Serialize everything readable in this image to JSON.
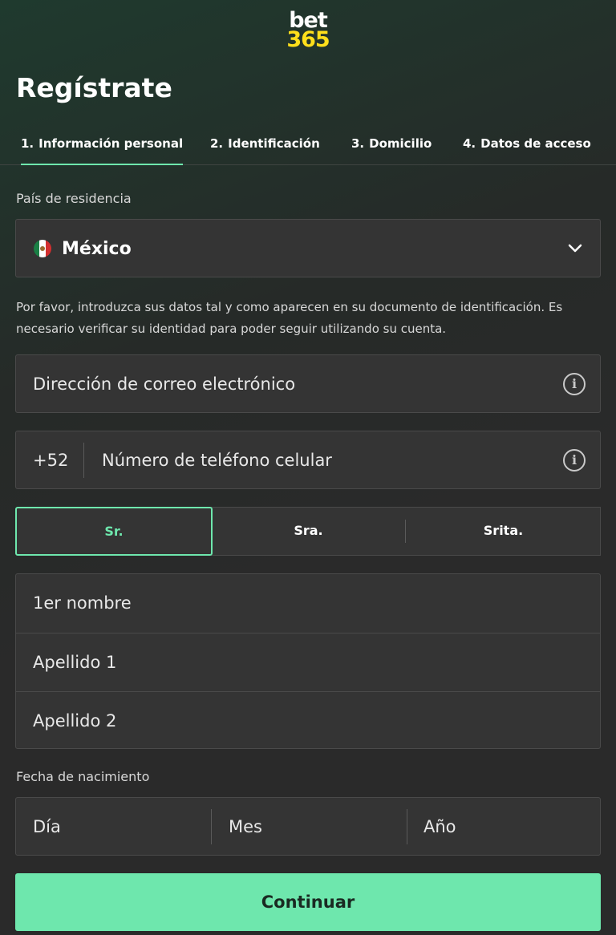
{
  "logo": {
    "line1": "bet",
    "line2": "365"
  },
  "page_title": "Regístrate",
  "tabs": [
    {
      "num": "1.",
      "label": "Información personal"
    },
    {
      "num": "2.",
      "label": "Identificación"
    },
    {
      "num": "3.",
      "label": "Domicilio"
    },
    {
      "num": "4.",
      "label": "Datos de acceso"
    }
  ],
  "country": {
    "label": "País de residencia",
    "value": "México"
  },
  "notice": "Por favor, introduzca sus datos tal y como aparecen en su documento de identificación. Es necesario verificar su identidad para poder seguir utilizando su cuenta.",
  "email": {
    "placeholder": "Dirección de correo electrónico"
  },
  "phone": {
    "prefix": "+52",
    "placeholder": "Número de teléfono celular"
  },
  "titles": [
    "Sr.",
    "Sra.",
    "Srita."
  ],
  "names": {
    "first": "1er nombre",
    "last1": "Apellido 1",
    "last2": "Apellido 2"
  },
  "dob": {
    "label": "Fecha de nacimiento",
    "day": "Día",
    "month": "Mes",
    "year": "Año"
  },
  "continue_label": "Continuar",
  "colors": {
    "accent": "#6ee7ad",
    "brand_yellow": "#ffdf1b",
    "field_bg": "#343434"
  },
  "icons": {
    "info": "info-icon",
    "dropdown": "chevron-down-icon",
    "flag": "mexico-flag-icon"
  }
}
